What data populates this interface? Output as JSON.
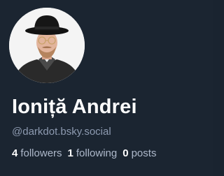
{
  "profile": {
    "display_name": "Ioniță Andrei",
    "handle": "@darkdot.bsky.social",
    "avatar_icon": "user-avatar-photo",
    "stats": {
      "followers_count": "4",
      "followers_label": "followers",
      "following_count": "1",
      "following_label": "following",
      "posts_count": "0",
      "posts_label": "posts"
    }
  },
  "colors": {
    "background": "#1b2531",
    "name": "#ffffff",
    "handle": "#8d9ab0",
    "stat_label": "#aeb9cb"
  }
}
